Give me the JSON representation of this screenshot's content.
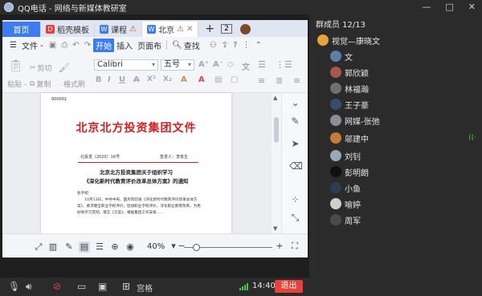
{
  "window": {
    "app_name": "QQ电话",
    "separator": " - ",
    "group_name": "网络与新媒体教研室",
    "controls": [
      "—",
      "□",
      "✕"
    ]
  },
  "share": {
    "tabs": [
      {
        "label": "首页",
        "badge": "",
        "badge_color": ""
      },
      {
        "label": "稻壳模板",
        "badge": "D",
        "badge_color": "#e8403a"
      },
      {
        "label": "课程",
        "badge": "W",
        "badge_color": "#3d7cf0",
        "warning": "⚠"
      },
      {
        "label": "北京",
        "badge": "W",
        "badge_color": "#3d7cf0",
        "warning": "⚠"
      }
    ],
    "tab_count": "2",
    "menu": {
      "file": "文件",
      "start": "开始",
      "insert": "插入",
      "page": "页面布",
      "search": "查找"
    },
    "ribbon": {
      "paste": "粘贴",
      "cut": "剪切",
      "copy": "复制",
      "format_painter": "格式刷",
      "font": "Calibri",
      "size": "五号",
      "format_buttons": [
        "B",
        "I",
        "U",
        "A",
        "X²",
        "X₂",
        "A",
        "A"
      ]
    },
    "document": {
      "number": "000001",
      "red_title": "北京北方投资集团文件",
      "doc_no": "北投发〔2020〕16号",
      "signer": "签发人：李俊生",
      "heading1": "北京北方投资集团关于组织学习",
      "heading2": "《深化新时代教育评价改革总体方案》的通知",
      "body": "各学校：\n　　10月13日，中共中央、国务院印发《深化新时代教育评价改革总体方案》，要求健全职业学校评价，促进职业学校评价，深化职业教育改革。为更好地学习贯彻，落实《方案》，根据集团工作安排……"
    },
    "status": {
      "zoom": "40%"
    }
  },
  "callbar": {
    "layout_label": "宫格",
    "time": "14:40",
    "hangup_label": "退出"
  },
  "members": {
    "header": "群成员 12/13",
    "list": [
      {
        "name": "视觉—康晓文",
        "color": "#e8a23a"
      },
      {
        "name": "文",
        "color": "#5c7ea8"
      },
      {
        "name": "郭欣颖",
        "color": "#a5594a"
      },
      {
        "name": "林福瀚",
        "color": "#6f6f6f"
      },
      {
        "name": "王子豪",
        "color": "#3a4b6b"
      },
      {
        "name": "网媒-张弛",
        "color": "#8a8f96"
      },
      {
        "name": "邬建中",
        "color": "#c47a3b"
      },
      {
        "name": "刘钊",
        "color": "#9aa7b6"
      },
      {
        "name": "彭明朗",
        "color": "#101010"
      },
      {
        "name": "小鱼",
        "color": "#2d3d4f"
      },
      {
        "name": "喻婷",
        "color": "#d3cfc7"
      },
      {
        "name": "周军",
        "color": "#4a4a4a"
      }
    ],
    "speaking_indicator": "((·"
  }
}
